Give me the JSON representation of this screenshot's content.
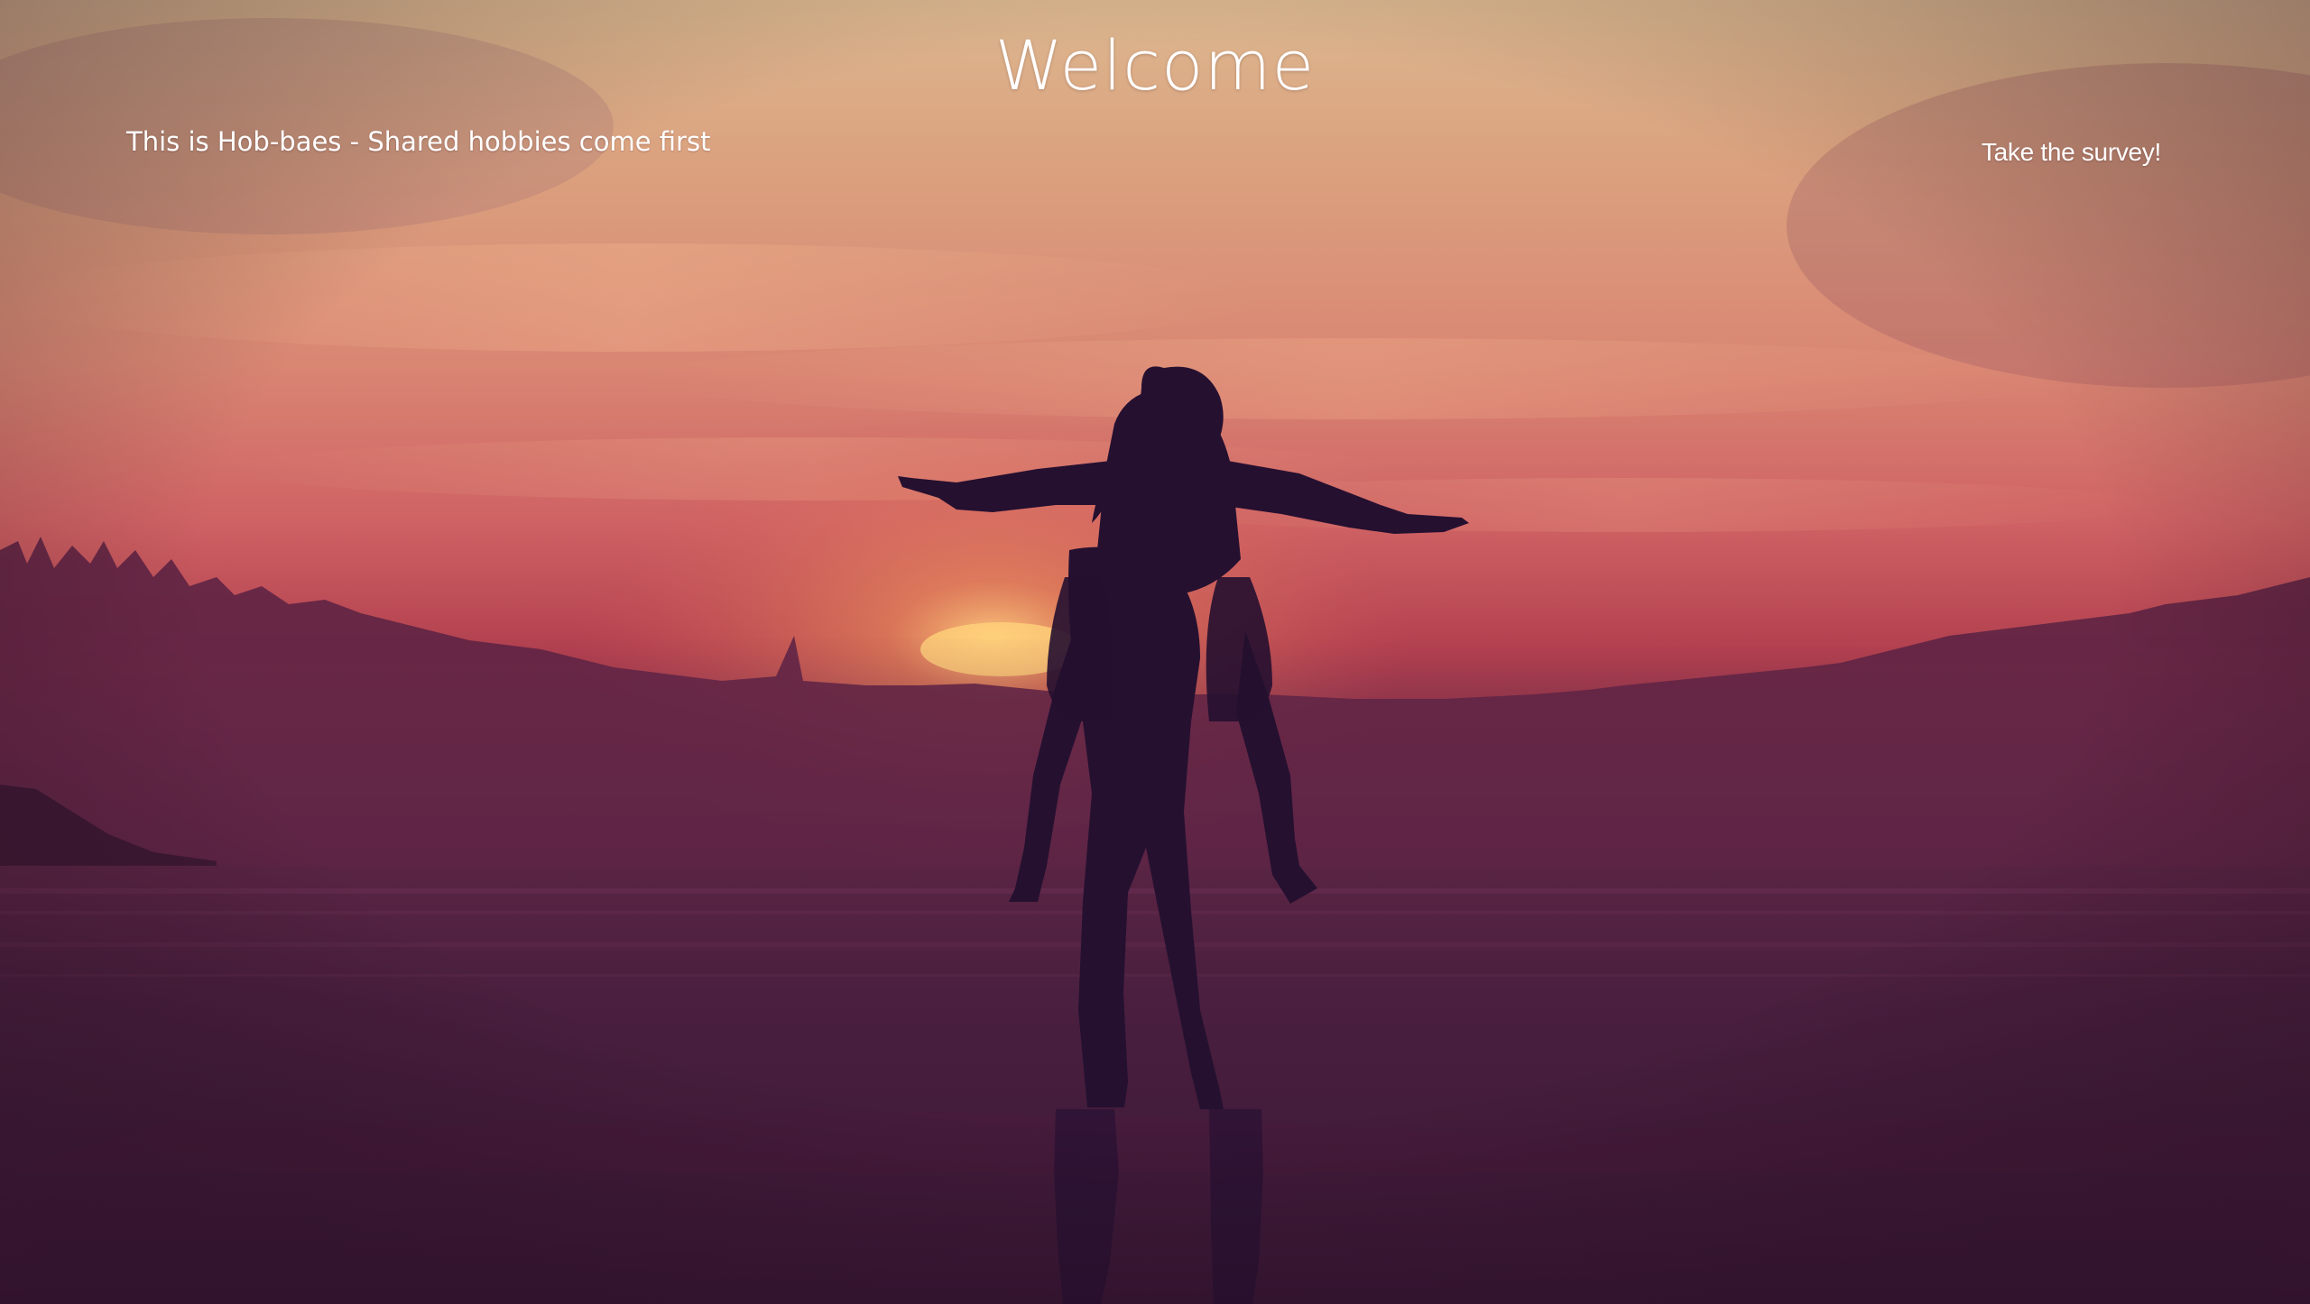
{
  "page": {
    "title": "Welcome",
    "tagline": "This is Hob-baes - Shared hobbies come first"
  },
  "nav": {
    "survey_label": "Take the survey!"
  },
  "background": {
    "description_icon": "sunset-beach-couple-silhouette-image",
    "colors": {
      "sky_top": "#dcb28c",
      "sky_mid": "#d7706a",
      "sky_low": "#a53a4c",
      "treeline": "#4a1f3d",
      "water": "#3e1a3a",
      "silhouette": "#1f0f2a"
    }
  }
}
